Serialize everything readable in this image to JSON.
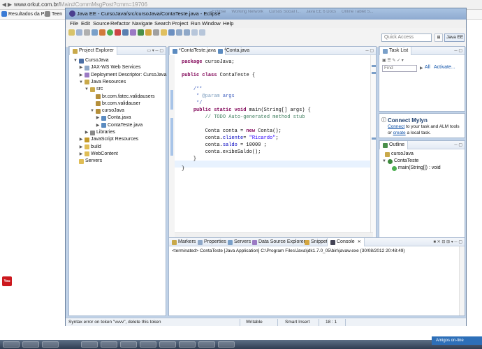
{
  "browser": {
    "url_main": "www.orkut.com.br/",
    "url_rest": "Main#CommMsgPost?cmm=19706",
    "bookmarks": [
      "Resultados da P...",
      "Teen"
    ]
  },
  "eclipse": {
    "title": "Java EE - CursoJava/src/cursoJava/ContaTeste.java - Eclipse",
    "bg_tabs": [
      "Eclipse",
      "Working Network",
      "Cursos Social I...",
      "Java EE 6 Docs",
      "Online Tablet S..."
    ],
    "menu": [
      "File",
      "Edit",
      "Source",
      "Refactor",
      "Navigate",
      "Search",
      "Project",
      "Run",
      "Window",
      "Help"
    ],
    "quick_access_placeholder": "Quick Access",
    "perspective": "Java EE",
    "project_explorer": {
      "tab": "Project Explorer",
      "tree": [
        {
          "label": "CursoJava",
          "twisty": "▼",
          "icon": "project"
        },
        {
          "label": "JAX-WS Web Services",
          "twisty": "▶",
          "icon": "ws"
        },
        {
          "label": "Deployment Descriptor: CursoJava",
          "twisty": "▶",
          "icon": "dd"
        },
        {
          "label": "Java Resources",
          "twisty": "▼",
          "icon": "jres"
        },
        {
          "label": "src",
          "twisty": "▼",
          "icon": "src"
        },
        {
          "label": "br.com.fatec.validausers",
          "twisty": "",
          "icon": "pkg"
        },
        {
          "label": "br.com.validauser",
          "twisty": "",
          "icon": "pkg"
        },
        {
          "label": "cursoJava",
          "twisty": "▼",
          "icon": "pkg"
        },
        {
          "label": "Conta.java",
          "twisty": "▶",
          "icon": "java"
        },
        {
          "label": "ContaTeste.java",
          "twisty": "▶",
          "icon": "java"
        },
        {
          "label": "Libraries",
          "twisty": "▶",
          "icon": "lib"
        },
        {
          "label": "JavaScript Resources",
          "twisty": "▶",
          "icon": "js"
        },
        {
          "label": "build",
          "twisty": "▶",
          "icon": "folder"
        },
        {
          "label": "WebContent",
          "twisty": "▶",
          "icon": "folder"
        },
        {
          "label": "Servers",
          "twisty": "",
          "icon": "folder"
        }
      ]
    },
    "editor": {
      "tabs": [
        "*ContaTeste.java",
        "*Conta.java"
      ]
    },
    "task_list": {
      "tab": "Task List",
      "find_placeholder": "Find",
      "all_label": "All",
      "activate_label": "Activate..."
    },
    "mylyn": {
      "title": "Connect Mylyn",
      "line1_link": "Connect",
      "line1_rest": " to your task and ALM tools",
      "line2_pre": "or ",
      "line2_link": "create",
      "line2_rest": " a local task."
    },
    "outline": {
      "tab": "Outline",
      "package": "cursoJava",
      "class": "ContaTeste",
      "method": "main(String[]) : void"
    },
    "bottom_tabs": [
      "Markers",
      "Properties",
      "Servers",
      "Data Source Explorer",
      "Snippets",
      "Console"
    ],
    "console_text": "<terminated> ContaTeste [Java Application] C:\\Program Files\\Java\\jdk1.7.0_05\\bin\\javaw.exe (30/08/2012 20:48:49)",
    "status": {
      "message": "Syntax error on token \"vvvv\", delete this token",
      "writable": "Writable",
      "insert_mode": "Smart Insert",
      "position": "18 : 1"
    }
  },
  "taskbar": {
    "amigos": "Amigos on-line"
  }
}
